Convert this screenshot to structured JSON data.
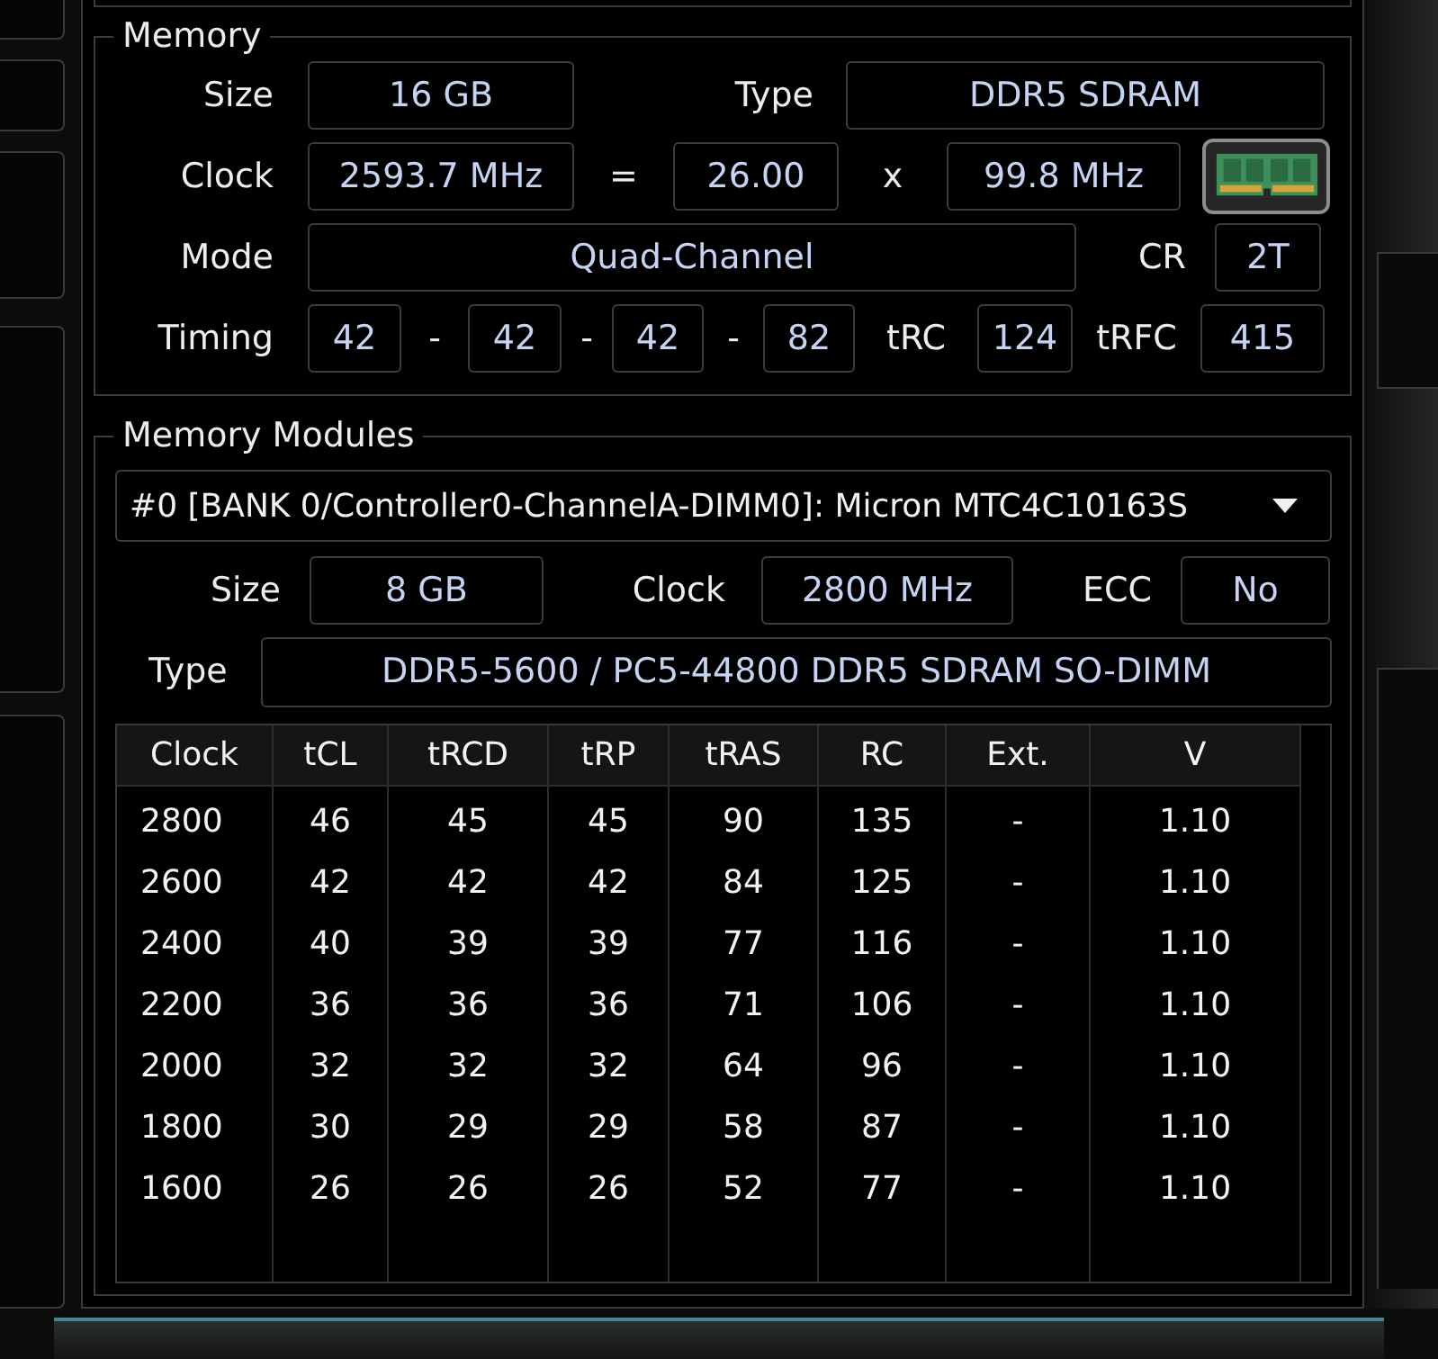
{
  "memory": {
    "title": "Memory",
    "size": {
      "label": "Size",
      "value": "16 GB"
    },
    "type": {
      "label": "Type",
      "value": "DDR5 SDRAM"
    },
    "clock": {
      "label": "Clock",
      "value": "2593.7 MHz",
      "equals": "=",
      "multiplier": "26.00",
      "times": "x",
      "bus": "99.8 MHz"
    },
    "mode": {
      "label": "Mode",
      "value": "Quad-Channel"
    },
    "command_rate": {
      "label": "CR",
      "value": "2T"
    },
    "timing": {
      "label": "Timing",
      "values": [
        "42",
        "42",
        "42",
        "82"
      ],
      "separators": [
        "-",
        "-",
        "-"
      ],
      "trc": {
        "label": "tRC",
        "value": "124"
      },
      "trfc": {
        "label": "tRFC",
        "value": "415"
      }
    }
  },
  "memory_modules": {
    "title": "Memory Modules",
    "module_select": {
      "value": "#0 [BANK 0/Controller0-ChannelA-DIMM0]: Micron MTC4C10163S"
    },
    "size": {
      "label": "Size",
      "value": "8 GB"
    },
    "clock": {
      "label": "Clock",
      "value": "2800 MHz"
    },
    "ecc": {
      "label": "ECC",
      "value": "No"
    },
    "type": {
      "label": "Type",
      "value": "DDR5-5600 / PC5-44800 DDR5 SDRAM SO-DIMM"
    },
    "timings_table": {
      "columns": [
        "Clock",
        "tCL",
        "tRCD",
        "tRP",
        "tRAS",
        "RC",
        "Ext.",
        "V"
      ],
      "rows": [
        [
          "2800",
          "46",
          "45",
          "45",
          "90",
          "135",
          "-",
          "1.10"
        ],
        [
          "2600",
          "42",
          "42",
          "42",
          "84",
          "125",
          "-",
          "1.10"
        ],
        [
          "2400",
          "40",
          "39",
          "39",
          "77",
          "116",
          "-",
          "1.10"
        ],
        [
          "2200",
          "36",
          "36",
          "36",
          "71",
          "106",
          "-",
          "1.10"
        ],
        [
          "2000",
          "32",
          "32",
          "32",
          "64",
          "96",
          "-",
          "1.10"
        ],
        [
          "1800",
          "30",
          "29",
          "29",
          "58",
          "87",
          "-",
          "1.10"
        ],
        [
          "1600",
          "26",
          "26",
          "26",
          "52",
          "77",
          "-",
          "1.10"
        ]
      ]
    }
  }
}
